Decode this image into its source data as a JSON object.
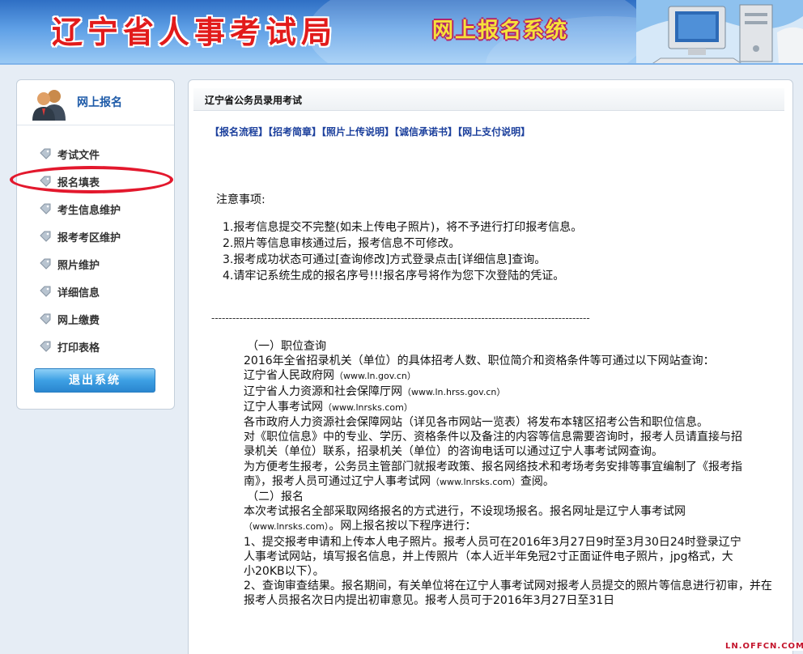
{
  "header": {
    "site_title": "辽宁省人事考试局",
    "system_title": "网上报名系统"
  },
  "sidebar": {
    "heading": "网上报名",
    "items": [
      {
        "label": "考试文件"
      },
      {
        "label": "报名填表"
      },
      {
        "label": "考生信息维护"
      },
      {
        "label": "报考考区维护"
      },
      {
        "label": "照片维护"
      },
      {
        "label": "详细信息"
      },
      {
        "label": "网上缴费"
      },
      {
        "label": "打印表格"
      }
    ],
    "logout_label": "退出系统",
    "highlighted_item": "报名填表"
  },
  "main": {
    "title": "辽宁省公务员录用考试",
    "links": [
      "【报名流程】",
      "【招考简章】",
      "【照片上传说明】",
      "【诚信承诺书】",
      "【网上支付说明】"
    ],
    "notice_title": "注意事项:",
    "notices": [
      "1.报考信息提交不完整(如未上传电子照片)，将不予进行打印报考信息。",
      "2.照片等信息审核通过后，报考信息不可修改。",
      "3.报考成功状态可通过[查询修改]方式登录点击[详细信息]查询。",
      "4.请牢记系统生成的报名序号!!!报名序号将作为您下次登陆的凭证。"
    ],
    "divider": "------------------------------------------------------------------------------------------------------------",
    "article": {
      "s1_title": "（一）职位查询",
      "s1_p1": "2016年全省招录机关（单位）的具体招考人数、职位简介和资格条件等可通过以下网站查询：",
      "site1_name": "辽宁省人民政府网",
      "site1_url": "（www.ln.gov.cn）",
      "site2_name": "辽宁省人力资源和社会保障厅网",
      "site2_url": "（www.ln.hrss.gov.cn）",
      "site3_name": "辽宁人事考试网",
      "site3_url": "（www.lnrsks.com）",
      "s1_p2": "各市政府人力资源社会保障网站（详见各市网站一览表）将发布本辖区招考公告和职位信息。",
      "s1_p3": "对《职位信息》中的专业、学历、资格条件以及备注的内容等信息需要咨询时，报考人员请直接与招录机关（单位）联系，招录机关（单位）的咨询电话可以通过辽宁人事考试网查询。",
      "s1_p4_a": "为方便考生报考，公务员主管部门就报考政策、报名网络技术和考场考务安排等事宜编制了《报考指南》，报考人员可通过辽宁人事考试网",
      "s1_p4_url": "（www.lnrsks.com）",
      "s1_p4_b": "查阅。",
      "s2_title": "（二）报名",
      "s2_p1_a": "本次考试报名全部采取网络报名的方式进行，不设现场报名。报名网址是辽宁人事考试网",
      "s2_p1_url": "（www.lnrsks.com）",
      "s2_p1_b": "。网上报名按以下程序进行：",
      "s2_p2": "1、提交报考申请和上传本人电子照片。报考人员可在2016年3月27日9时至3月30日24时登录辽宁人事考试网站，填写报名信息，并上传照片（本人近半年免冠2寸正面证件电子照片，jpg格式，大小20KB以下）。",
      "s2_p3": "2、查询审查结果。报名期间，有关单位将在辽宁人事考试网对报考人员提交的照片等信息进行初审，并在报考人员报名次日内提出初审意见。报考人员可于2016年3月27日至31日"
    }
  },
  "watermark": "LN.OFFCN.COM",
  "colors": {
    "site_title": "#e21b1b",
    "links": "#1b3f9c",
    "highlight_ellipse": "#e3182d",
    "header_blue": "#5fa0e6"
  }
}
